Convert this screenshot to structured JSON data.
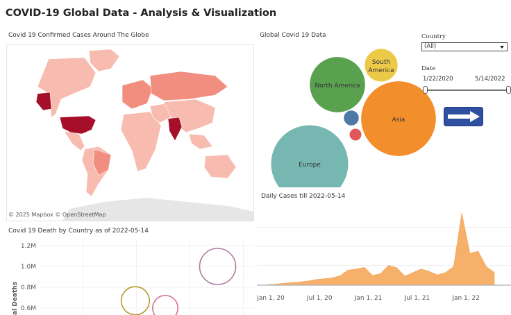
{
  "page": {
    "title": "COVID-19 Global Data - Analysis & Visualization"
  },
  "map_panel": {
    "title": "Covid 19 Confirmed Cases Around The Globe",
    "credit": "© 2025 Mapbox  © OpenStreetMap"
  },
  "bubble_panel": {
    "title": "Global Covid 19 Data"
  },
  "controls": {
    "country_label": "Country",
    "country_value": "(All)",
    "date_label": "Date",
    "date_start": "1/22/2020",
    "date_end": "5/14/2022",
    "date_start_level": 0.0,
    "date_end_level": 1.0
  },
  "daily_cases": {
    "title": "Daily Cases till 2022-05-14"
  },
  "death_panel": {
    "title": "Covid 19 Death by Country as of 2022-05-14",
    "ylabel": "al Deaths"
  },
  "colors": {
    "north_america": "#59a14f",
    "south_america": "#edc948",
    "asia": "#f28e2b",
    "europe": "#76b7b2",
    "blue_small": "#4e79a7",
    "red_small": "#e15759",
    "area_fill": "#f7b06a",
    "map_light": "#f7bbb0",
    "map_mid": "#f28e7f",
    "map_dark": "#a50f29",
    "button": "#2f4fa0"
  },
  "chart_data": [
    {
      "type": "scatter",
      "title": "Global Covid 19 Data",
      "points": [
        {
          "label": "North America",
          "size": 0.72,
          "color": "#59a14f"
        },
        {
          "label": "South America",
          "size": 0.43,
          "color": "#edc948"
        },
        {
          "label": "Asia",
          "size": 0.97,
          "color": "#f28e2b"
        },
        {
          "label": "Europe",
          "size": 1.0,
          "color": "#76b7b2"
        },
        {
          "label": "",
          "size": 0.2,
          "color": "#4e79a7"
        },
        {
          "label": "",
          "size": 0.16,
          "color": "#e15759"
        }
      ]
    },
    {
      "type": "area",
      "title": "Daily Cases till 2022-05-14",
      "x_ticks": [
        "Jan 1, 20",
        "Jul 1, 20",
        "Jan 1, 21",
        "Jul 1, 21",
        "Jan 1, 22"
      ],
      "x": [
        "2020-01",
        "2020-02",
        "2020-03",
        "2020-04",
        "2020-05",
        "2020-06",
        "2020-07",
        "2020-08",
        "2020-09",
        "2020-10",
        "2020-11",
        "2020-12",
        "2021-01",
        "2021-02",
        "2021-03",
        "2021-04",
        "2021-05",
        "2021-06",
        "2021-07",
        "2021-08",
        "2021-09",
        "2021-10",
        "2021-11",
        "2021-12",
        "2022-01",
        "2022-02",
        "2022-03",
        "2022-04",
        "2022-05"
      ],
      "values": [
        0.0,
        0.01,
        0.05,
        0.08,
        0.1,
        0.14,
        0.2,
        0.24,
        0.27,
        0.36,
        0.6,
        0.65,
        0.72,
        0.38,
        0.45,
        0.8,
        0.7,
        0.35,
        0.5,
        0.65,
        0.55,
        0.4,
        0.5,
        0.75,
        3.0,
        1.3,
        1.4,
        0.75,
        0.5
      ]
    },
    {
      "type": "scatter",
      "title": "Covid 19 Death by Country as of 2022-05-14",
      "ylabel": "al Deaths",
      "y_ticks": [
        "1.2M",
        "1.0M",
        "0.8M",
        "0.6M"
      ],
      "points": [
        {
          "x": 0.5,
          "y": 1000000,
          "size": 1.0,
          "color": "#b07aa1"
        },
        {
          "x": 0.28,
          "y": 670000,
          "size": 0.78,
          "color": "#b6992d"
        },
        {
          "x": 0.36,
          "y": 600000,
          "size": 0.7,
          "color": "#d37295"
        }
      ]
    }
  ]
}
